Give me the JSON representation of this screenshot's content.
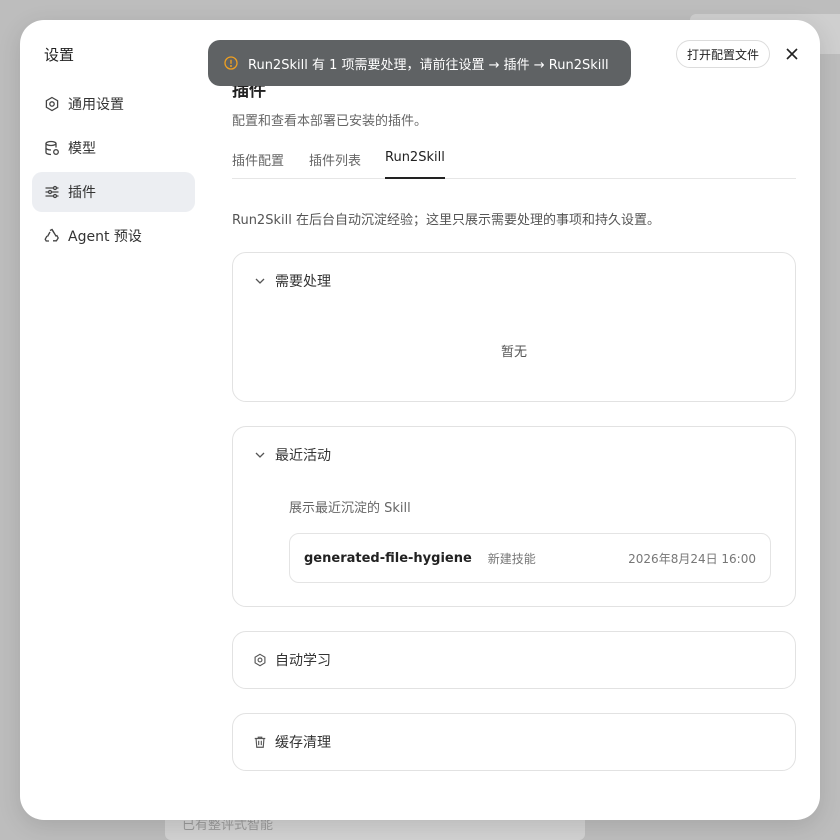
{
  "toast": {
    "message": "Run2Skill 有 1 项需要处理，请前往设置 → 插件 → Run2Skill",
    "icon": "warning-circle-icon",
    "icon_color": "#f0a020"
  },
  "header": {
    "open_config_label": "打开配置文件",
    "close_icon": "close-icon"
  },
  "sidebar": {
    "title": "设置",
    "items": [
      {
        "label": "通用设置",
        "icon": "gear-icon"
      },
      {
        "label": "模型",
        "icon": "database-icon"
      },
      {
        "label": "插件",
        "icon": "sliders-icon",
        "active": true
      },
      {
        "label": "Agent 预设",
        "icon": "recycle-icon"
      }
    ]
  },
  "main": {
    "title": "插件",
    "subtitle": "配置和查看本部署已安装的插件。",
    "tabs": [
      {
        "label": "插件配置"
      },
      {
        "label": "插件列表"
      },
      {
        "label": "Run2Skill",
        "active": true
      }
    ],
    "intro": "Run2Skill 在后台自动沉淀经验；这里只展示需要处理的事项和持久设置。",
    "pending": {
      "title": "需要处理",
      "empty_text": "暂无"
    },
    "recent": {
      "title": "最近活动",
      "subtitle": "展示最近沉淀的 Skill",
      "items": [
        {
          "name": "generated-file-hygiene",
          "tag": "新建技能",
          "time": "2026年8月24日 16:00"
        }
      ]
    },
    "auto_learn": {
      "title": "自动学习",
      "icon": "gear-icon"
    },
    "cache_cleanup": {
      "title": "缓存清理",
      "icon": "trash-icon"
    }
  },
  "backdrop": {
    "text": "已有整评式智能"
  }
}
